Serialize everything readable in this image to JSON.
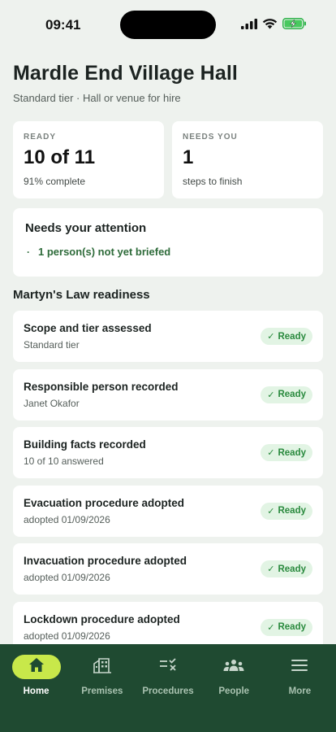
{
  "status_bar": {
    "time": "09:41"
  },
  "header": {
    "title": "Mardle End Village Hall",
    "subtitle": "Standard tier · Hall or venue for hire"
  },
  "stats": [
    {
      "label": "READY",
      "value": "10 of 11",
      "note": "91% complete"
    },
    {
      "label": "NEEDS YOU",
      "value": "1",
      "note": "steps to finish"
    }
  ],
  "attention": {
    "title": "Needs your attention",
    "items": [
      {
        "bullet": "·",
        "text": "1 person(s) not yet briefed"
      }
    ]
  },
  "section_title": "Martyn's Law readiness",
  "readiness": [
    {
      "title": "Scope and tier assessed",
      "subtitle": "Standard tier",
      "status": "Ready"
    },
    {
      "title": "Responsible person recorded",
      "subtitle": "Janet Okafor",
      "status": "Ready"
    },
    {
      "title": "Building facts recorded",
      "subtitle": "10 of 10 answered",
      "status": "Ready"
    },
    {
      "title": "Evacuation procedure adopted",
      "subtitle": "adopted 01/09/2026",
      "status": "Ready"
    },
    {
      "title": "Invacuation procedure adopted",
      "subtitle": "adopted 01/09/2026",
      "status": "Ready"
    },
    {
      "title": "Lockdown procedure adopted",
      "subtitle": "adopted 01/09/2026",
      "status": "Ready"
    }
  ],
  "badge_check": "✓",
  "tabs": [
    {
      "label": "Home",
      "icon": "home-icon",
      "active": true
    },
    {
      "label": "Premises",
      "icon": "building-icon",
      "active": false
    },
    {
      "label": "Procedures",
      "icon": "checklist-icon",
      "active": false
    },
    {
      "label": "People",
      "icon": "people-icon",
      "active": false
    },
    {
      "label": "More",
      "icon": "menu-icon",
      "active": false
    }
  ],
  "colors": {
    "background": "#eef2ee",
    "tab_bar": "#1f4a31",
    "active_tab_pill": "#c8e84a",
    "ready_badge_bg": "#e2f4e4",
    "ready_badge_text": "#2a8a3e",
    "attention_text": "#2e6b3a"
  }
}
